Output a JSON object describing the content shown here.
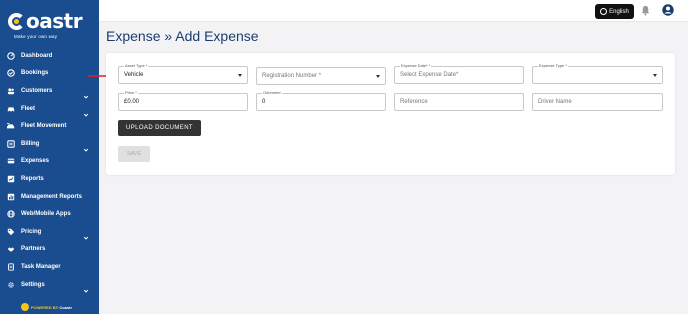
{
  "app": {
    "logo_text": "oastr",
    "logo_tagline": "Make your own way",
    "powered_by": "POWERED BY",
    "powered_brand": "Coastr"
  },
  "sidebar": {
    "items": [
      {
        "label": "Dashboard",
        "icon": "dashboard-icon",
        "has_chevron": false
      },
      {
        "label": "Bookings",
        "icon": "bookings-icon",
        "has_chevron": false
      },
      {
        "label": "Customers",
        "icon": "customers-icon",
        "has_chevron": true
      },
      {
        "label": "Fleet",
        "icon": "fleet-icon",
        "has_chevron": true
      },
      {
        "label": "Fleet Movement",
        "icon": "fleet-movement-icon",
        "has_chevron": false
      },
      {
        "label": "Billing",
        "icon": "billing-icon",
        "has_chevron": true
      },
      {
        "label": "Expenses",
        "icon": "expenses-icon",
        "has_chevron": false
      },
      {
        "label": "Reports",
        "icon": "reports-icon",
        "has_chevron": false
      },
      {
        "label": "Management Reports",
        "icon": "management-reports-icon",
        "has_chevron": false
      },
      {
        "label": "Web/Mobile Apps",
        "icon": "globe-icon",
        "has_chevron": false
      },
      {
        "label": "Pricing",
        "icon": "tag-icon",
        "has_chevron": true
      },
      {
        "label": "Partners",
        "icon": "partners-icon",
        "has_chevron": false
      },
      {
        "label": "Task Manager",
        "icon": "task-icon",
        "has_chevron": false
      },
      {
        "label": "Settings",
        "icon": "gear-icon",
        "has_chevron": true
      }
    ]
  },
  "topbar": {
    "language_label": "English"
  },
  "page": {
    "title": "Expense  »  Add Expense"
  },
  "form": {
    "asset_type": {
      "label": "Asset Type *",
      "value": "Vehicle"
    },
    "registration": {
      "placeholder": "Registration Number *"
    },
    "expense_date": {
      "label": "Expense Date* *",
      "placeholder": "Select Expense Date*"
    },
    "expense_type": {
      "label": "Expense Type *",
      "value": ""
    },
    "price": {
      "label": "Price *",
      "value": "£0.00"
    },
    "odometer": {
      "label": "Odometer",
      "value": "0"
    },
    "reference": {
      "placeholder": "Reference"
    },
    "driver_name": {
      "placeholder": "Driver Name"
    },
    "upload_label": "UPLOAD DOCUMENT",
    "save_label": "SAVE"
  },
  "colors": {
    "sidebar_bg": "#1a4d8f",
    "accent_yellow": "#f5c518",
    "arrow_red": "#e02020",
    "title_blue": "#1a3d6e"
  }
}
